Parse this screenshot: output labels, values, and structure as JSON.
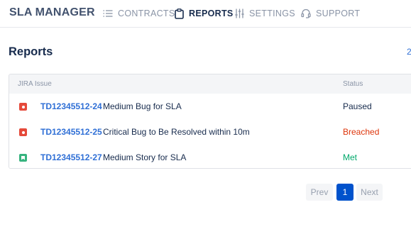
{
  "app": {
    "brand": "SLA MANAGER"
  },
  "nav": {
    "contracts": "CONTRACTS",
    "reports": "REPORTS",
    "settings": "SETTINGS",
    "support": "SUPPORT"
  },
  "page": {
    "title": "Reports",
    "right_marker": "2"
  },
  "table": {
    "headers": {
      "issue": "JIRA Issue",
      "status": "Status"
    },
    "rows": [
      {
        "type_icon": "bug-icon",
        "key": "TD12345512-24",
        "summary": "Medium Bug for SLA",
        "status": "Paused",
        "status_color": "#172b4d"
      },
      {
        "type_icon": "bug-icon",
        "key": "TD12345512-25",
        "summary": "Critical Bug to Be Resolved within 10m",
        "status": "Breached",
        "status_color": "#de350b"
      },
      {
        "type_icon": "story-icon",
        "key": "TD12345512-27",
        "summary": "Medium Story for SLA",
        "status": "Met",
        "status_color": "#00a86b"
      }
    ]
  },
  "pagination": {
    "prev": "Prev",
    "current": "1",
    "next": "Next"
  },
  "colors": {
    "accent": "#0052cc",
    "link": "#2f6fd6",
    "breached": "#de350b",
    "met": "#00a86b",
    "bug": "#e5493a",
    "story": "#36b37e"
  }
}
